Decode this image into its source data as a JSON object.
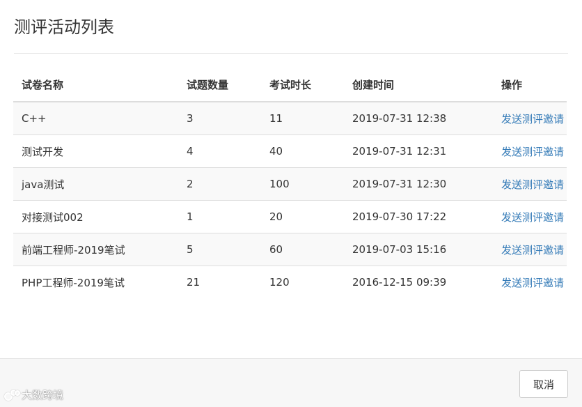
{
  "modal": {
    "title": "测评活动列表",
    "cancel_label": "取消"
  },
  "table": {
    "headers": [
      "试卷名称",
      "试题数量",
      "考试时长",
      "创建时间",
      "操作"
    ],
    "rows": [
      {
        "name": "C++",
        "count": "3",
        "duration": "11",
        "created": "2019-07-31 12:38",
        "action": "发送测评邀请"
      },
      {
        "name": "测试开发",
        "count": "4",
        "duration": "40",
        "created": "2019-07-31 12:31",
        "action": "发送测评邀请"
      },
      {
        "name": "java测试",
        "count": "2",
        "duration": "100",
        "created": "2019-07-31 12:30",
        "action": "发送测评邀请"
      },
      {
        "name": "对接测试002",
        "count": "1",
        "duration": "20",
        "created": "2019-07-30 17:22",
        "action": "发送测评邀请"
      },
      {
        "name": "前端工程师-2019笔试",
        "count": "5",
        "duration": "60",
        "created": "2019-07-03 15:16",
        "action": "发送测评邀请"
      },
      {
        "name": "PHP工程师-2019笔试",
        "count": "21",
        "duration": "120",
        "created": "2016-12-15 09:39",
        "action": "发送测评邀请"
      }
    ]
  },
  "watermark": {
    "text": "大数跨境",
    "icon": "brand-logo-icon"
  }
}
